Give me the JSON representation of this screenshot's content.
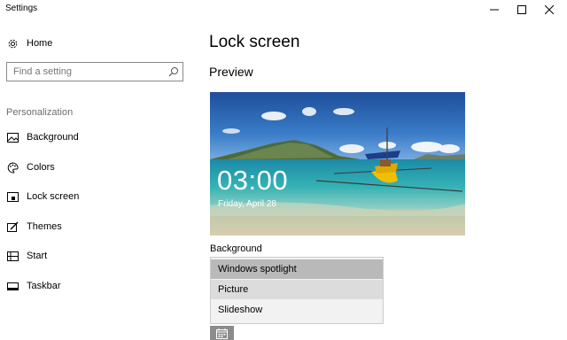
{
  "window": {
    "title": "Settings"
  },
  "sidebar": {
    "home_label": "Home",
    "search_placeholder": "Find a setting",
    "section_label": "Personalization",
    "items": [
      {
        "label": "Background",
        "icon": "picture-icon"
      },
      {
        "label": "Colors",
        "icon": "palette-icon"
      },
      {
        "label": "Lock screen",
        "icon": "lock-screen-icon"
      },
      {
        "label": "Themes",
        "icon": "themes-icon"
      },
      {
        "label": "Start",
        "icon": "start-icon"
      },
      {
        "label": "Taskbar",
        "icon": "taskbar-icon"
      }
    ]
  },
  "main": {
    "title": "Lock screen",
    "preview_label": "Preview",
    "preview": {
      "time": "03:00",
      "date": "Friday, April 28"
    },
    "background_label": "Background",
    "background_options": [
      {
        "label": "Windows spotlight",
        "state": "selected"
      },
      {
        "label": "Picture",
        "state": "hover"
      },
      {
        "label": "Slideshow",
        "state": "normal"
      }
    ]
  },
  "colors": {
    "accent_selected": "#b9b9b9",
    "hover": "#dcdcdc",
    "dropdown_bg": "#f2f2f2"
  }
}
